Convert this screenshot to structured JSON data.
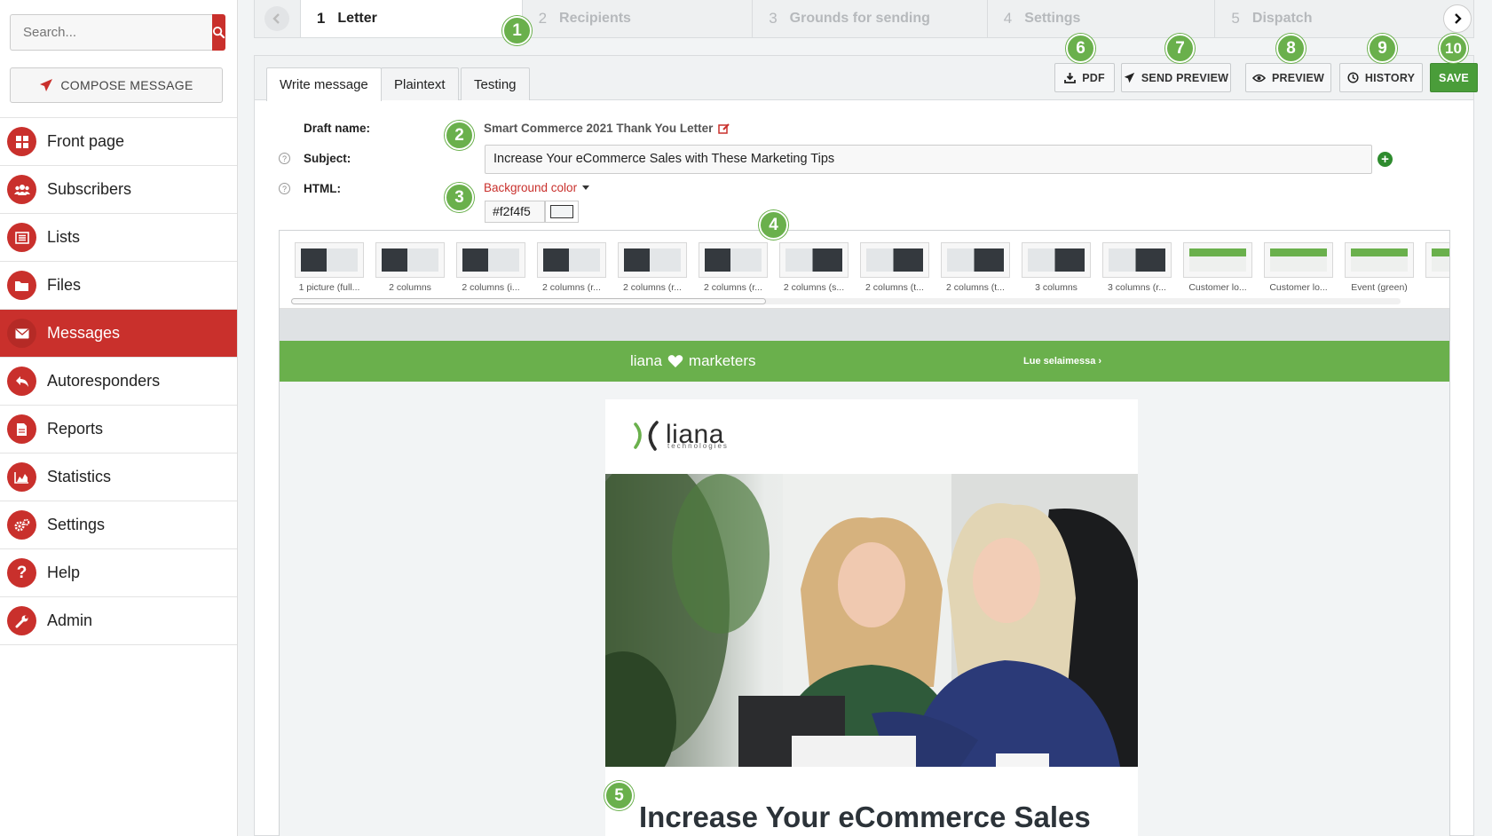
{
  "sidebar": {
    "search_placeholder": "Search...",
    "compose_label": "COMPOSE MESSAGE",
    "items": [
      {
        "label": "Front page",
        "icon": "dashboard-icon"
      },
      {
        "label": "Subscribers",
        "icon": "users-icon"
      },
      {
        "label": "Lists",
        "icon": "list-icon"
      },
      {
        "label": "Files",
        "icon": "folder-icon"
      },
      {
        "label": "Messages",
        "icon": "envelope-icon",
        "active": true
      },
      {
        "label": "Autoresponders",
        "icon": "reply-icon"
      },
      {
        "label": "Reports",
        "icon": "report-icon"
      },
      {
        "label": "Statistics",
        "icon": "area-chart-icon"
      },
      {
        "label": "Settings",
        "icon": "gears-icon"
      },
      {
        "label": "Help",
        "icon": "question-icon"
      },
      {
        "label": "Admin",
        "icon": "wrench-icon"
      }
    ]
  },
  "stepper": {
    "steps": [
      {
        "num": "1",
        "label": "Letter",
        "active": true
      },
      {
        "num": "2",
        "label": "Recipients"
      },
      {
        "num": "3",
        "label": "Grounds for sending"
      },
      {
        "num": "4",
        "label": "Settings"
      },
      {
        "num": "5",
        "label": "Dispatch"
      }
    ]
  },
  "tabs": [
    "Write message",
    "Plaintext",
    "Testing"
  ],
  "toolbar": {
    "pdf": "PDF",
    "send_preview": "SEND PREVIEW",
    "preview": "PREVIEW",
    "history": "HISTORY",
    "save": "SAVE"
  },
  "form": {
    "draft_label": "Draft name:",
    "draft_value": "Smart Commerce 2021 Thank You Letter",
    "subject_label": "Subject:",
    "subject_value": "Increase Your eCommerce Sales with These Marketing Tips",
    "html_label": "HTML:",
    "bg_color_label": "Background color",
    "bg_color_value": "#f2f4f5"
  },
  "blocks": [
    "1 picture (full...",
    "2 columns",
    "2 columns (i...",
    "2 columns (r...",
    "2 columns (r...",
    "2 columns (r...",
    "2 columns (s...",
    "2 columns (t...",
    "2 columns (t...",
    "3 columns",
    "3 columns (r...",
    "Customer lo...",
    "Customer lo...",
    "Event (green)",
    "Ever"
  ],
  "email": {
    "brand_left": "liana",
    "brand_right": "marketers",
    "browser_link": "Lue selaimessa ›",
    "logo_text": "liana",
    "logo_sub": "technologies",
    "headline": "Increase Your eCommerce Sales"
  },
  "callouts": [
    "1",
    "2",
    "3",
    "4",
    "5",
    "6",
    "7",
    "8",
    "9",
    "10"
  ],
  "colors": {
    "accent_red": "#c9302c",
    "brand_green": "#6ab04c",
    "save_green": "#4a9d3a",
    "background": "#f2f4f5"
  }
}
